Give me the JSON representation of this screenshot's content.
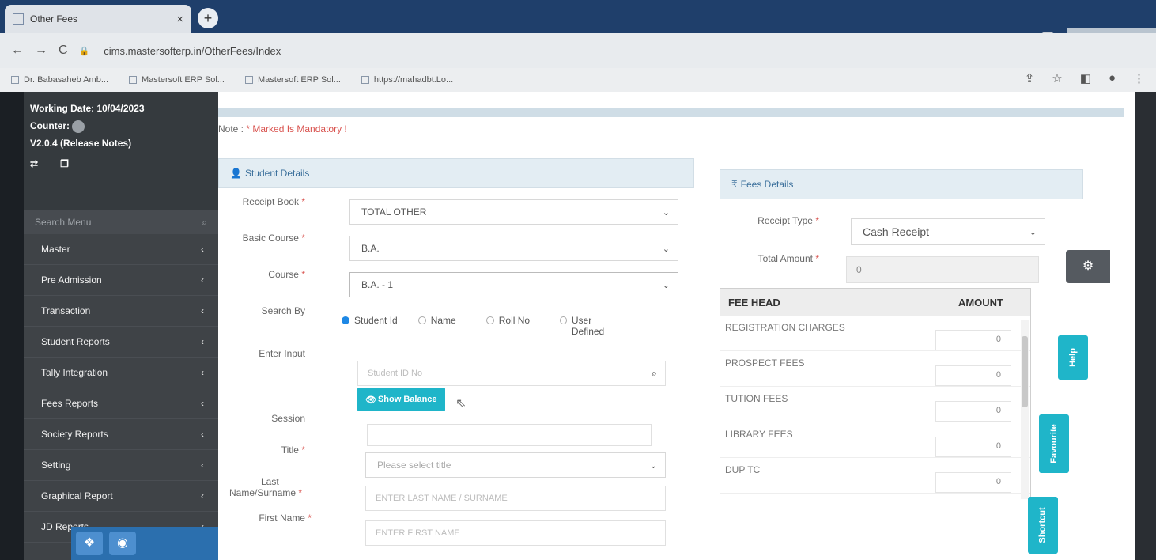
{
  "browser": {
    "tab_title": "Other Fees",
    "tab_close": "×",
    "new_tab": "+",
    "url": "cims.mastersofterp.in/OtherFees/Index",
    "bookmarks": [
      "Dr. Babasaheb Amb...",
      "Mastersoft ERP Sol...",
      "Mastersoft ERP Sol...",
      "https://mahadbt.Lo..."
    ]
  },
  "sidebar": {
    "working_date": "Working Date: 10/04/2023",
    "counter_label": "Counter:",
    "version": "V2.0.4 (Release Notes)",
    "search_placeholder": "Search Menu",
    "items": [
      "Master",
      "Pre Admission",
      "Transaction",
      "Student Reports",
      "Tally Integration",
      "Fees Reports",
      "Society Reports",
      "Setting",
      "Graphical Report",
      "JD Reports"
    ]
  },
  "note": {
    "prefix": "Note : ",
    "text": "* Marked Is Mandatory !"
  },
  "student_details": {
    "title": "Student Details",
    "receipt_book_label": "Receipt Book",
    "receipt_book_value": "TOTAL OTHER",
    "basic_course_label": "Basic Course",
    "basic_course_value": "B.A.",
    "course_label": "Course",
    "course_value": "B.A. - 1",
    "search_by_label": "Search By",
    "search_options": [
      "Student Id",
      "Name",
      "Roll No",
      "User Defined"
    ],
    "selected_option": "Student Id",
    "enter_input_label": "Enter Input",
    "enter_input_placeholder": "Student ID No",
    "show_balance": "Show Balance",
    "session_label": "Session",
    "title_label": "Title",
    "title_placeholder": "Please select title",
    "last_name_label_1": "Last",
    "last_name_label_2": "Name/Surname",
    "last_name_placeholder": "ENTER LAST NAME / SURNAME",
    "first_name_label": "First Name",
    "first_name_placeholder": "ENTER FIRST NAME"
  },
  "fees_details": {
    "title": "Fees Details",
    "receipt_type_label": "Receipt Type",
    "receipt_type_value": "Cash Receipt",
    "total_amount_label": "Total Amount",
    "total_amount_value": "0",
    "table_headers": [
      "FEE HEAD",
      "AMOUNT"
    ],
    "rows": [
      {
        "head": "REGISTRATION CHARGES",
        "amount": "0"
      },
      {
        "head": "PROSPECT FEES",
        "amount": "0"
      },
      {
        "head": "TUTION FEES",
        "amount": "0"
      },
      {
        "head": "LIBRARY FEES",
        "amount": "0"
      },
      {
        "head": "DUP TC",
        "amount": "0"
      }
    ]
  },
  "floaters": {
    "help": "Help",
    "favourite": "Favourite",
    "shortcut": "Shortcut"
  },
  "colors": {
    "accent": "#1fb5c9",
    "sidebar": "#3f4347",
    "mandatory": "#d9534f"
  }
}
